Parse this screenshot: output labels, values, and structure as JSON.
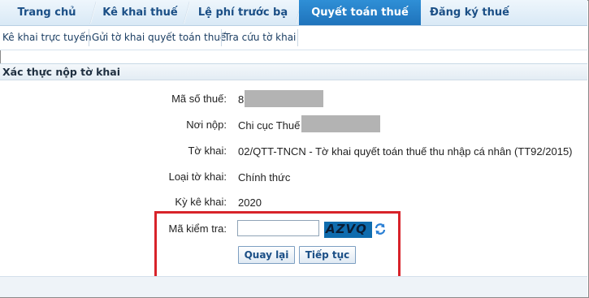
{
  "tabs": [
    {
      "label": "Trang chủ"
    },
    {
      "label": "Kê khai thuế"
    },
    {
      "label": "Lệ phí trước bạ"
    },
    {
      "label": "Quyết toán thuế",
      "active": true
    },
    {
      "label": "Đăng ký thuế"
    }
  ],
  "subnav": [
    {
      "label": "Kê khai trực tuyến"
    },
    {
      "label": "Gửi tờ khai quyết toán thuế"
    },
    {
      "label": "Tra cứu tờ khai"
    }
  ],
  "panel": {
    "title": "Xác thực nộp tờ khai"
  },
  "form": {
    "tax_code_label": "Mã số thuế:",
    "tax_code_value": "8",
    "submit_place_label": "Nơi nộp:",
    "submit_place_value": "Chi cục Thuế",
    "declaration_label": "Tờ khai:",
    "declaration_value": "02/QTT-TNCN - Tờ khai quyết toán thuế thu nhập cá nhân (TT92/2015)",
    "declaration_type_label": "Loại tờ khai:",
    "declaration_type_value": "Chính thức",
    "period_label": "Kỳ kê khai:",
    "period_value": "2020",
    "captcha_label": "Mã kiểm tra:",
    "captcha_input_value": "",
    "captcha_code": "AZVQ"
  },
  "buttons": {
    "back": "Quay lại",
    "continue": "Tiếp tục"
  },
  "colors": {
    "tab_active": "#1f73bb",
    "tab_text": "#1b4f86",
    "highlight": "#d8232a",
    "captcha_bg": "#0f6cae"
  }
}
